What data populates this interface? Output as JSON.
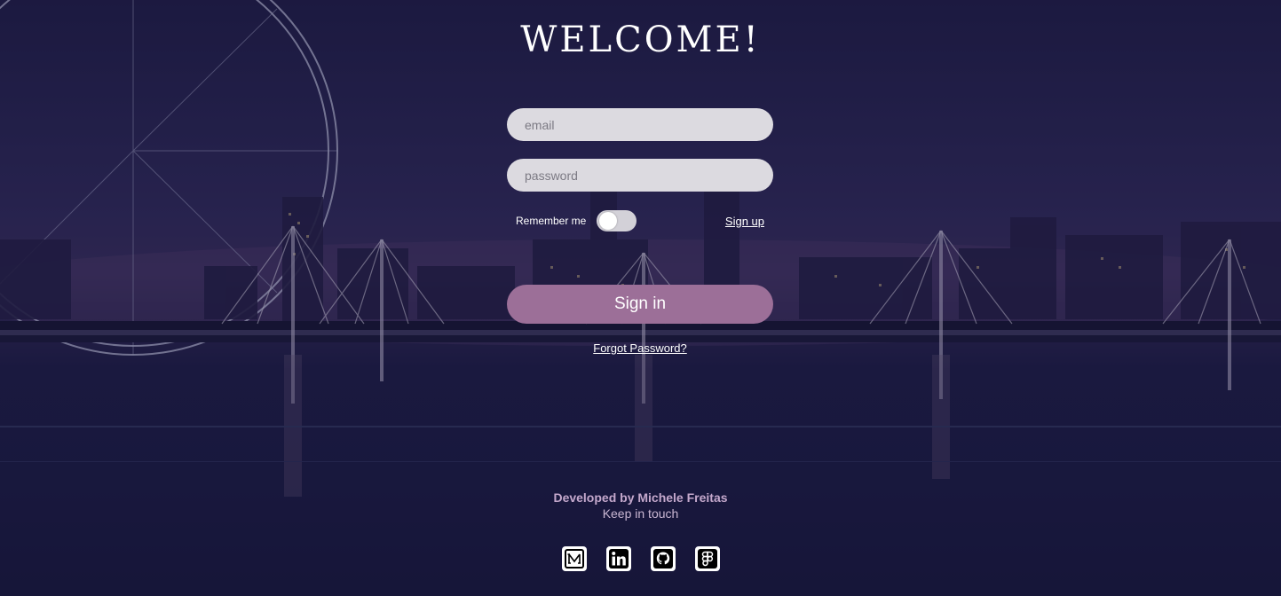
{
  "header": {
    "title": "WELCOME!"
  },
  "form": {
    "email_placeholder": "email",
    "password_placeholder": "password",
    "remember_label": "Remember me",
    "remember_on": false,
    "signup_label": "Sign up",
    "signin_label": "Sign in",
    "forgot_label": "Forgot Password?"
  },
  "footer": {
    "developer": "Developed by Michele Freitas",
    "keep_in_touch": "Keep in touch",
    "socials": [
      {
        "icon": "medium-icon"
      },
      {
        "icon": "linkedin-icon"
      },
      {
        "icon": "github-icon"
      },
      {
        "icon": "figma-icon"
      }
    ]
  },
  "colors": {
    "accent": "#9c6f98",
    "input_bg": "#dcdae0",
    "footer_text": "#c4a8cc",
    "background": "#1d1a3d"
  }
}
